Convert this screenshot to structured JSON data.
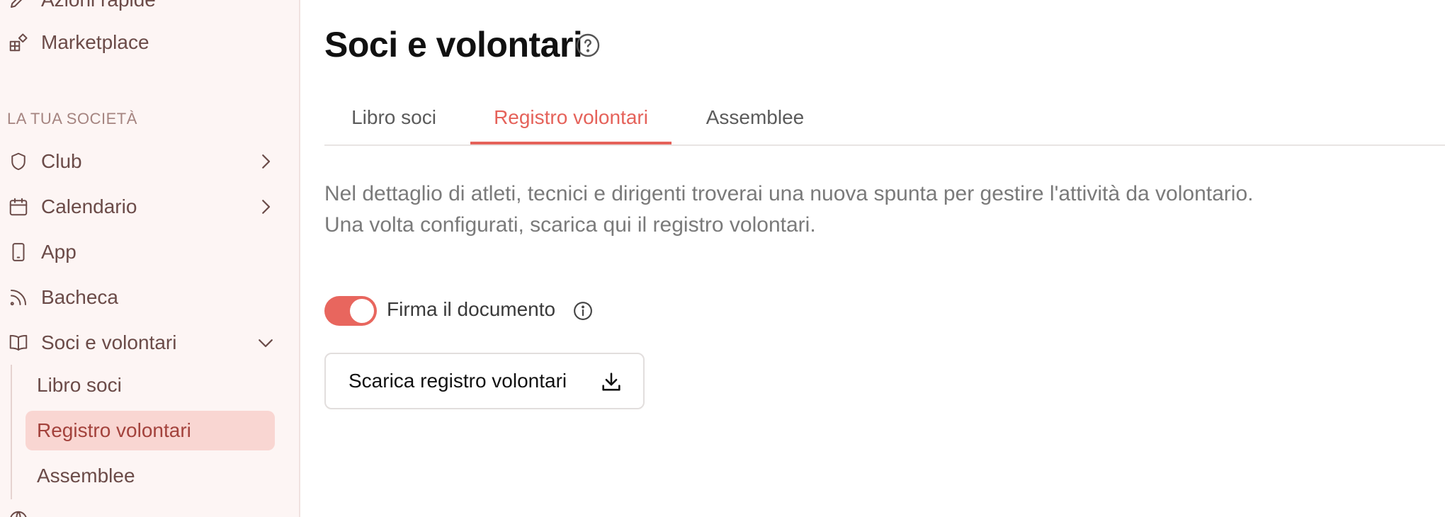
{
  "sidebar": {
    "top_items": [
      {
        "label": "Azioni rapide",
        "icon": "pencil-icon"
      },
      {
        "label": "Marketplace",
        "icon": "grid-plus-icon"
      }
    ],
    "section_title": "LA TUA SOCIETÀ",
    "items": [
      {
        "label": "Club",
        "icon": "shield-icon",
        "chevron": "chevron-right-icon"
      },
      {
        "label": "Calendario",
        "icon": "calendar-icon",
        "chevron": "chevron-right-icon"
      },
      {
        "label": "App",
        "icon": "phone-icon"
      },
      {
        "label": "Bacheca",
        "icon": "rss-icon"
      },
      {
        "label": "Soci e volontari",
        "icon": "book-icon",
        "chevron": "chevron-down-icon"
      }
    ],
    "sub_items": [
      {
        "label": "Libro soci",
        "active": false
      },
      {
        "label": "Registro volontari",
        "active": true
      },
      {
        "label": "Assemblee",
        "active": false
      }
    ]
  },
  "main": {
    "title": "Soci e volontari",
    "tabs": [
      {
        "label": "Libro soci",
        "active": false
      },
      {
        "label": "Registro volontari",
        "active": true
      },
      {
        "label": "Assemblee",
        "active": false
      }
    ],
    "description_line1": "Nel dettaglio di atleti, tecnici e dirigenti troverai una nuova spunta per gestire l'attività da volontario.",
    "description_line2": "Una volta configurati, scarica qui il registro volontari.",
    "toggle": {
      "label": "Firma il documento",
      "on": true
    },
    "download_button": "Scarica registro volontari"
  },
  "colors": {
    "accent": "#e5625a",
    "sidebar_bg": "#fdf5f4",
    "active_sub_bg": "#f9d6d2"
  }
}
